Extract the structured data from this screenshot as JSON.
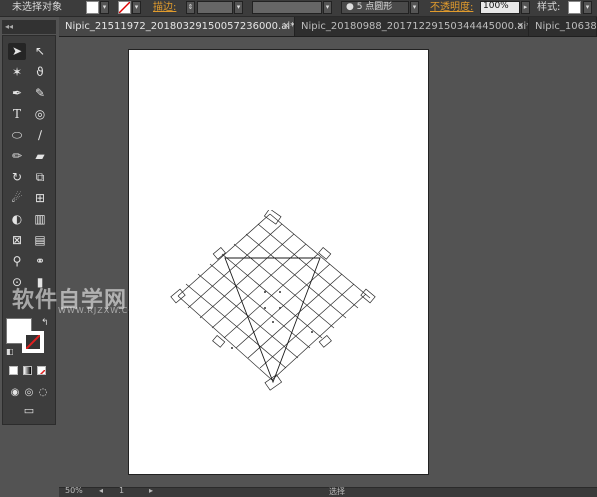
{
  "control_bar": {
    "selection_label": "未选择对象",
    "stroke_label": "描边:",
    "dot_size": "5 点圆形",
    "opacity_label": "不透明度:",
    "opacity_value": "100%",
    "style_label": "样式:"
  },
  "tabs": [
    {
      "label": "Nipic_21511972_20180329150057236000.ai*",
      "active": true
    },
    {
      "label": "Nipic_20180988_20171229150344445000.ai*",
      "active": false
    },
    {
      "label": "Nipic_10638",
      "active": false
    }
  ],
  "status_bar": {
    "zoom": "50%",
    "page": "1",
    "tool": "选择"
  },
  "watermark": {
    "main": "软件自学网",
    "sub": "WWW.RJZXW.COM"
  },
  "colors": {
    "ui_dark": "#3c3c3c",
    "accent_orange": "#e09b2d",
    "artboard": "#ffffff"
  }
}
